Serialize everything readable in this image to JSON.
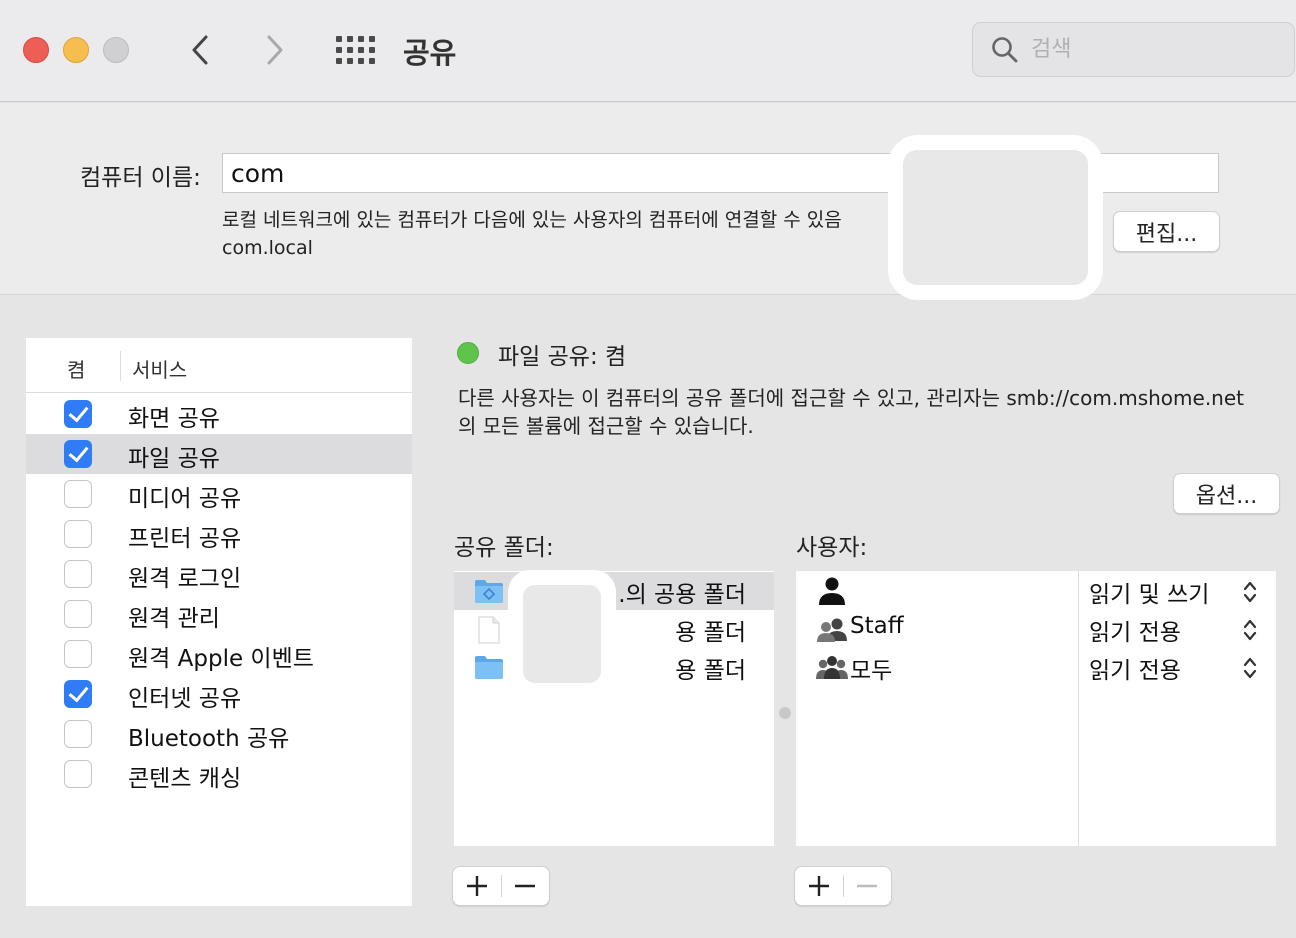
{
  "window": {
    "title": "공유",
    "search_placeholder": "검색"
  },
  "computer_name": {
    "label": "컴퓨터 이름:",
    "value": "com",
    "description": "로컬 네트워크에 있는 컴퓨터가 다음에 있는 사용자의 컴퓨터에 연결할 수 있음",
    "local_address": "com.local",
    "edit_button": "편집..."
  },
  "services": {
    "header_on": "켬",
    "header_service": "서비스",
    "items": [
      {
        "label": "화면 공유",
        "checked": true,
        "selected": false
      },
      {
        "label": "파일 공유",
        "checked": true,
        "selected": true
      },
      {
        "label": "미디어 공유",
        "checked": false,
        "selected": false
      },
      {
        "label": "프린터 공유",
        "checked": false,
        "selected": false
      },
      {
        "label": "원격 로그인",
        "checked": false,
        "selected": false
      },
      {
        "label": "원격 관리",
        "checked": false,
        "selected": false
      },
      {
        "label": "원격 Apple 이벤트",
        "checked": false,
        "selected": false
      },
      {
        "label": "인터넷 공유",
        "checked": true,
        "selected": false
      },
      {
        "label": "Bluetooth 공유",
        "checked": false,
        "selected": false
      },
      {
        "label": "콘텐츠 캐싱",
        "checked": false,
        "selected": false
      }
    ]
  },
  "detail": {
    "status": "파일 공유: 켬",
    "status_color": "#5ec44c",
    "description_line1": "다른 사용자는 이 컴퓨터의 공유 폴더에 접근할 수 있고, 관리자는 smb://com.mshome.net",
    "description_line2": "의 모든 볼륨에 접근할 수 있습니다.",
    "options_button": "옵션...",
    "shared_folders_label": "공유 폴더:",
    "users_label": "사용자:",
    "shared_folders": [
      {
        "name": "...의 공용 폴더",
        "icon": "public-folder-icon"
      },
      {
        "name": "용 폴더",
        "icon": "document-icon"
      },
      {
        "name": "용 폴더",
        "icon": "folder-icon"
      }
    ],
    "users": [
      {
        "name": "",
        "permission": "읽기 및 쓰기",
        "icon": "user-icon"
      },
      {
        "name": "Staff",
        "permission": "읽기 전용",
        "icon": "group-icon"
      },
      {
        "name": "모두",
        "permission": "읽기 전용",
        "icon": "everyone-icon"
      }
    ]
  },
  "colors": {
    "accent": "#2f7cf6",
    "selection": "#dcdcde"
  }
}
